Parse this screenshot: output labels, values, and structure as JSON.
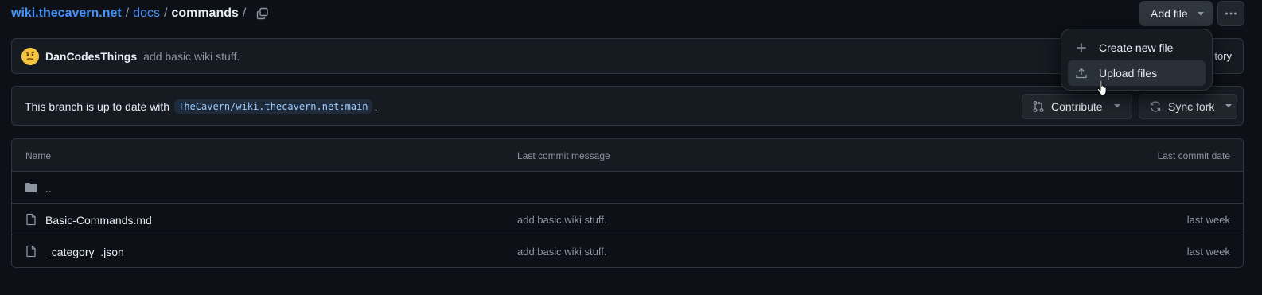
{
  "breadcrumb": {
    "repo": "wiki.thecavern.net",
    "sep": "/",
    "folder": "docs",
    "current": "commands"
  },
  "actions": {
    "add_file_label": "Add file",
    "more_label": "···"
  },
  "commit": {
    "author": "DanCodesThings",
    "message": "add basic wiki stuff.",
    "history_partial": "tory"
  },
  "branch": {
    "status_prefix": "This branch is up to date with",
    "ref": "TheCavern/wiki.thecavern.net:main",
    "status_suffix": ".",
    "contribute_label": "Contribute",
    "sync_label": "Sync fork"
  },
  "table": {
    "headers": {
      "name": "Name",
      "message": "Last commit message",
      "date": "Last commit date"
    },
    "rows": [
      {
        "name": "..",
        "type": "folder",
        "message": "",
        "date": ""
      },
      {
        "name": "Basic-Commands.md",
        "type": "file",
        "message": "add basic wiki stuff.",
        "date": "last week"
      },
      {
        "name": "_category_.json",
        "type": "file",
        "message": "add basic wiki stuff.",
        "date": "last week"
      }
    ]
  },
  "dropdown": {
    "items": [
      {
        "label": "Create new file",
        "icon": "plus-icon"
      },
      {
        "label": "Upload files",
        "icon": "upload-icon"
      }
    ]
  },
  "colors": {
    "background": "#0d1117",
    "link": "#4493f8",
    "border": "#30363d",
    "muted": "#8d96a0"
  }
}
